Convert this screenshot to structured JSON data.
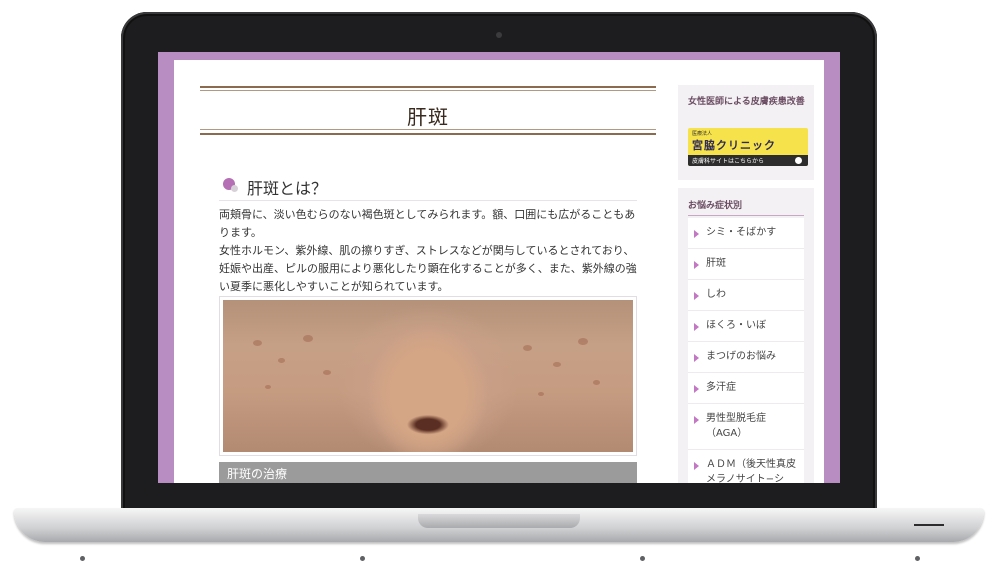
{
  "page": {
    "title": "肝斑",
    "section_title": "肝斑とは？",
    "paragraphs": [
      "両頬骨に、淡い色むらのない褐色斑としてみられます。額、口囲にも広がることもあります。",
      "女性ホルモン、紫外線、肌の擦りすぎ、ストレスなどが関与しているとされており、妊娠や出産、ピルの服用により悪化したり顕在化することが多く、また、紫外線の強い夏季に悪化しやすいことが知られています。"
    ],
    "photo_alt": "肝斑",
    "treatment_heading": "肝斑の治療"
  },
  "sidebar": {
    "box1_heading": "女性医師による皮膚疾患改善",
    "banner": {
      "small_text": "医療法人",
      "main_text": "宮脇クリニック",
      "foot_text": "皮膚科サイトはこちらから"
    },
    "box2_heading": "お悩み症状別",
    "menu": [
      "シミ・そばかす",
      "肝斑",
      "しわ",
      "ほくろ・いぼ",
      "まつげのお悩み",
      "多汗症",
      "男性型脱毛症（AGA）",
      "ＡＤＭ（後天性真皮メラノサイト−シス）"
    ]
  },
  "colors": {
    "accent_purple": "#b88ec2",
    "title_rule": "#8a6b4f",
    "treatment_bar": "#9b9b9b"
  }
}
